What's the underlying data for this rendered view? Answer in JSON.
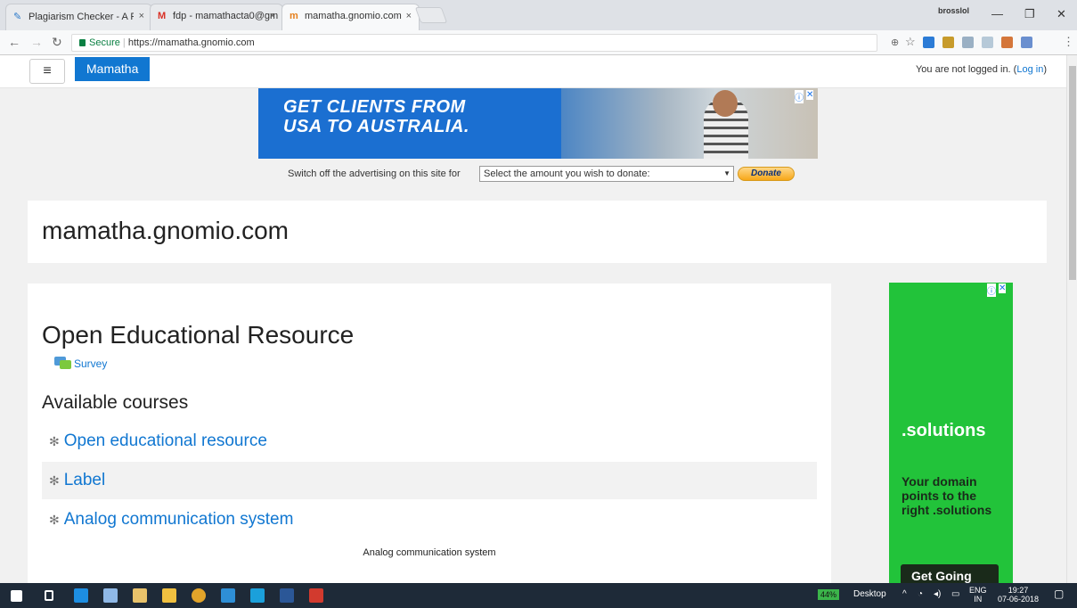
{
  "browser": {
    "tabs": [
      {
        "title": "Plagiarism Checker - A Fr",
        "icon": "PC"
      },
      {
        "title": "fdp - mamathacta0@gm",
        "icon": "M"
      },
      {
        "title": "mamatha.gnomio.com",
        "icon": "m"
      }
    ],
    "profile": "brosslol",
    "secure_label": "Secure",
    "url": "https://mamatha.gnomio.com"
  },
  "navbar": {
    "brand": "Mamatha",
    "login_text": "You are not logged in. (",
    "login_link": "Log in",
    "login_close": ")"
  },
  "ad_top": {
    "line1": "GET CLIENTS FROM",
    "line2": "USA TO AUSTRALIA."
  },
  "donate": {
    "label": "Switch off the advertising on this site for",
    "select_value": "Select the amount you wish to donate:",
    "button": "Donate"
  },
  "site": {
    "title": "mamatha.gnomio.com"
  },
  "main": {
    "heading": "Open Educational Resource",
    "survey_link": "Survey",
    "courses_heading": "Available courses",
    "courses": [
      {
        "name": "Open educational resource"
      },
      {
        "name": "Label"
      },
      {
        "name": "Analog communication system"
      }
    ],
    "course_summary": "Analog communication system"
  },
  "side_ad": {
    "domain": ".solutions",
    "text": "Your domain points to the right .solutions",
    "button": "Get Going"
  },
  "taskbar": {
    "battery": "44%",
    "desktop_label": "Desktop",
    "lang1": "ENG",
    "lang2": "IN",
    "time": "19:27",
    "date": "07-06-2018"
  }
}
